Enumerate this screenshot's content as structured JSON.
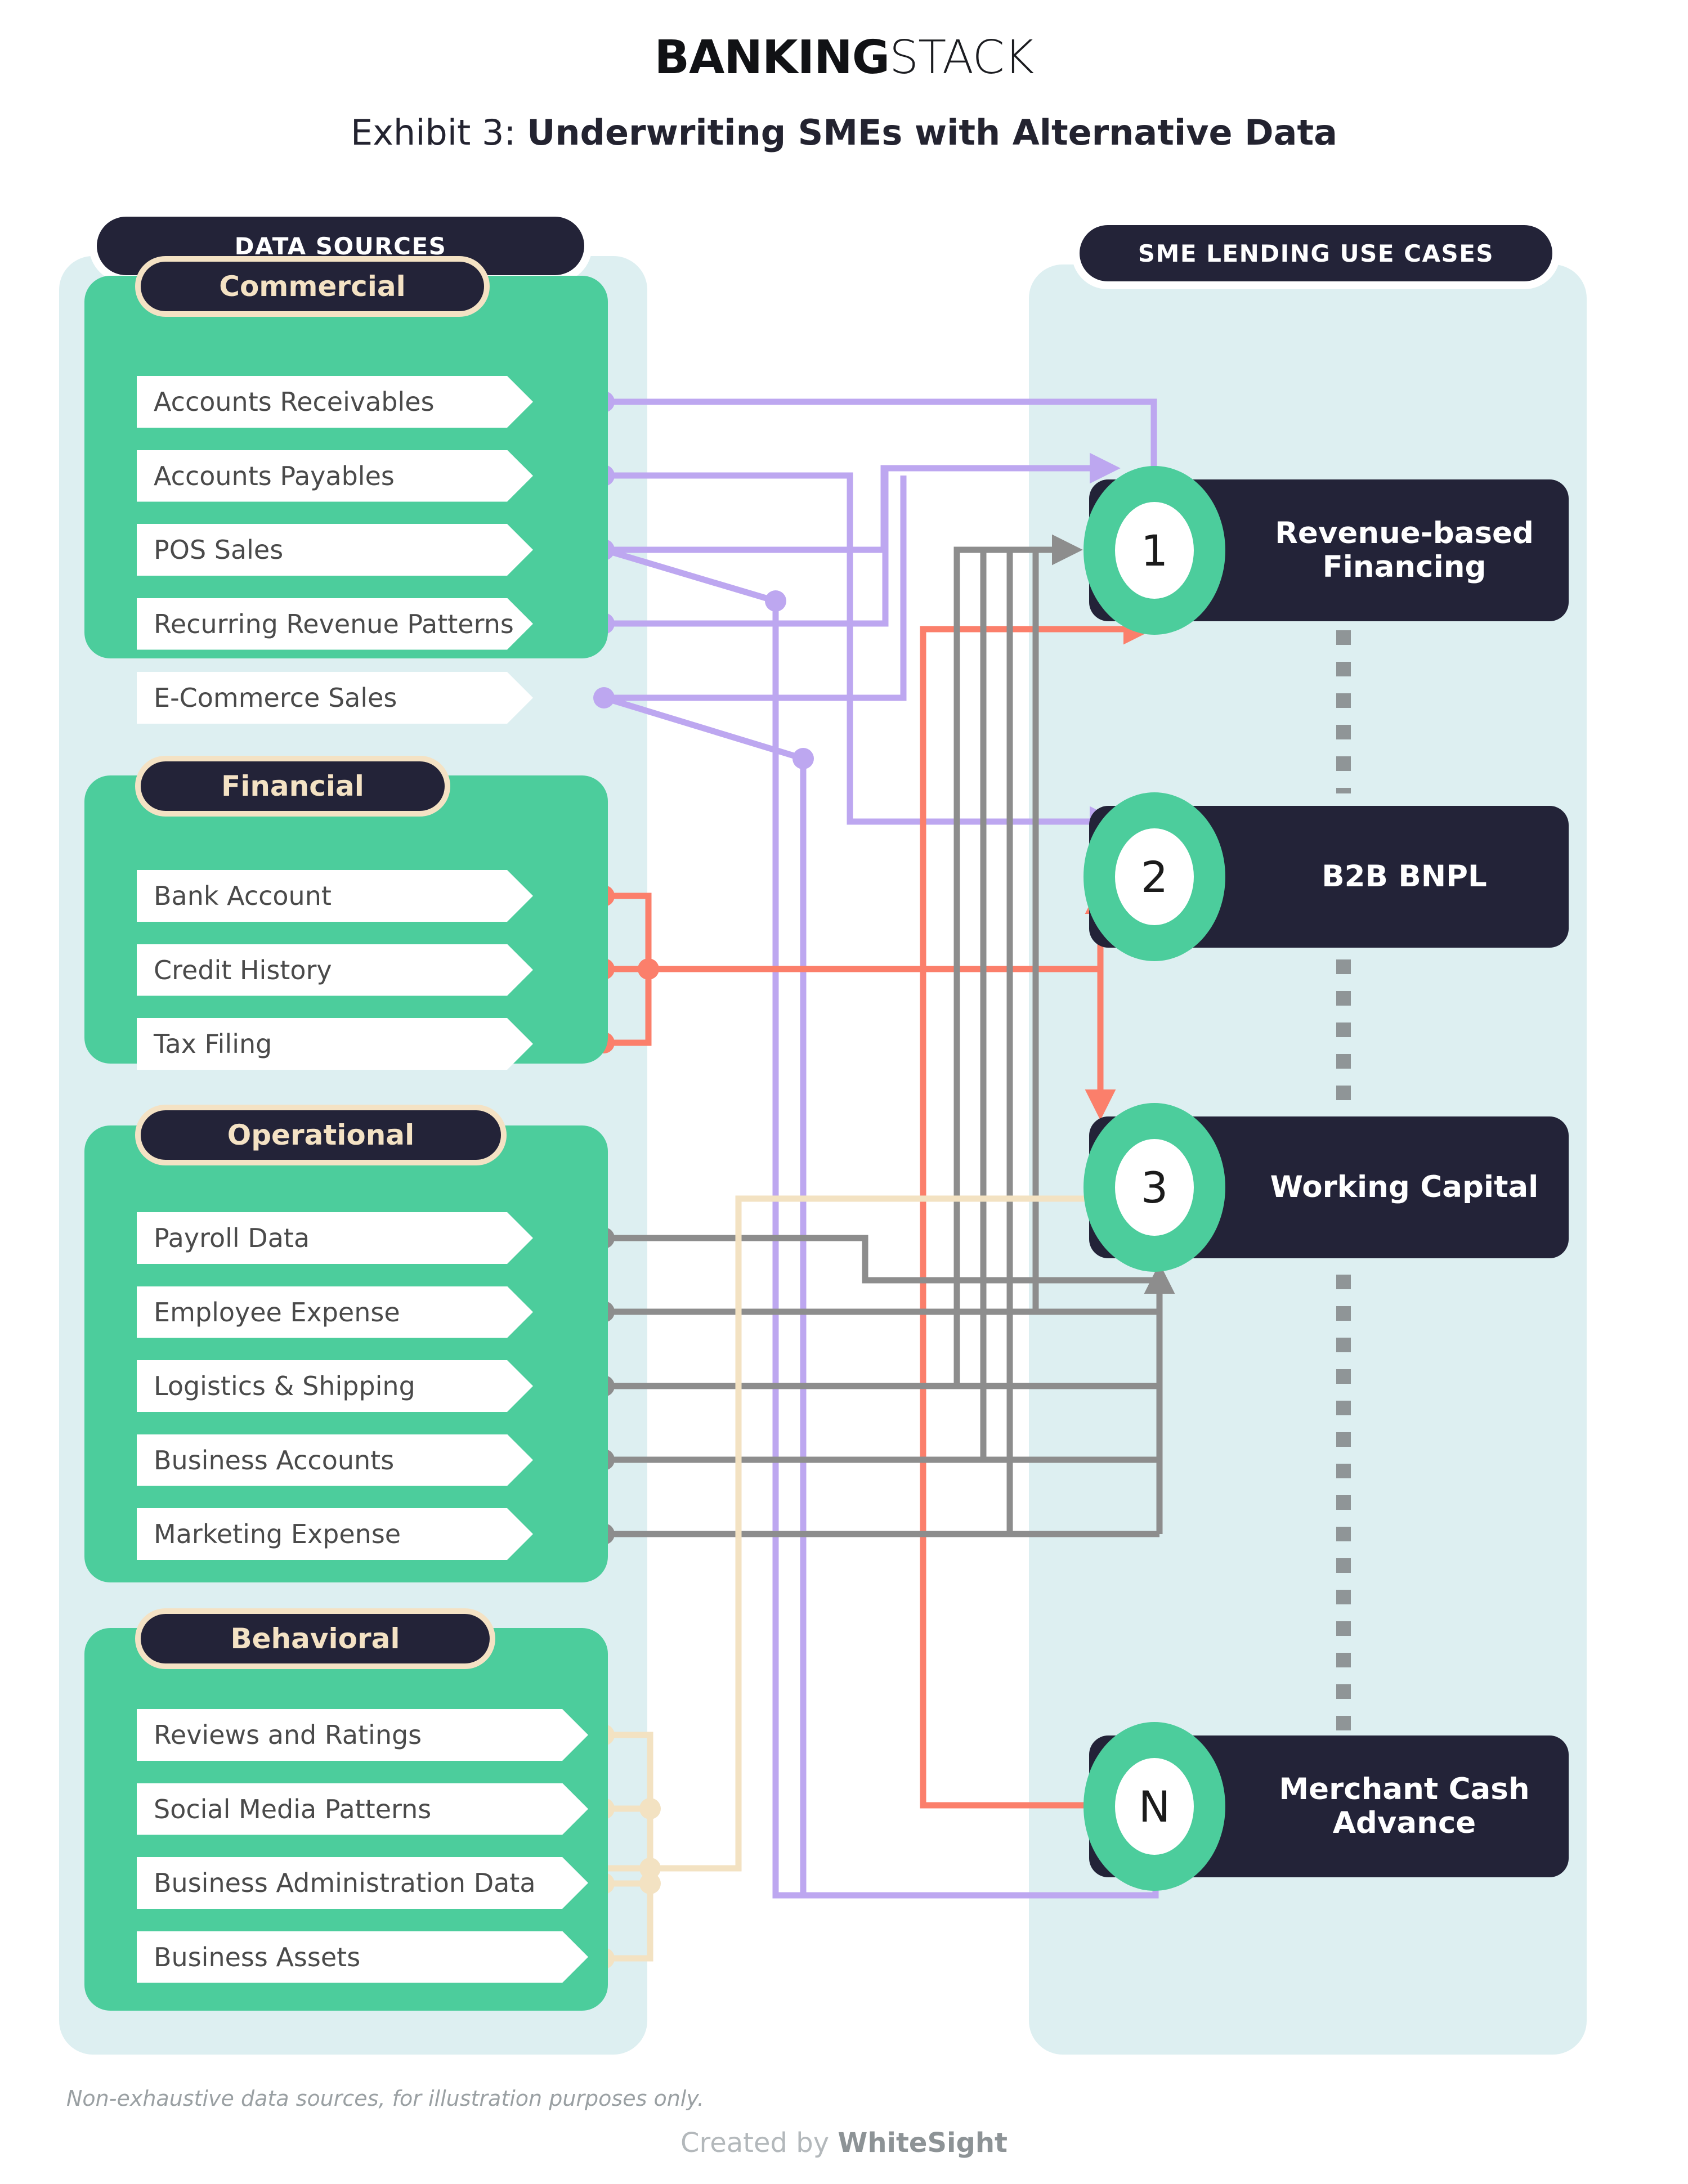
{
  "header": {
    "brand_bold": "BANKING",
    "brand_light": "STACK",
    "exhibit_prefix": "Exhibit 3: ",
    "exhibit_title": "Underwriting SMEs with Alternative Data"
  },
  "left_panel": {
    "tag": "DATA SOURCES",
    "groups": [
      {
        "title": "Commercial",
        "connector_color": "#bda7f0",
        "items": [
          "Accounts Receivables",
          "Accounts Payables",
          "POS Sales",
          "Recurring Revenue Patterns",
          "E-Commerce Sales"
        ]
      },
      {
        "title": "Financial",
        "connector_color": "#fb7f6b",
        "items": [
          "Bank Account",
          "Credit History",
          "Tax Filing"
        ]
      },
      {
        "title": "Operational",
        "connector_color": "#8d8d8d",
        "items": [
          "Payroll Data",
          "Employee Expense",
          "Logistics & Shipping",
          "Business Accounts",
          "Marketing Expense"
        ]
      },
      {
        "title": "Behavioral",
        "connector_color": "#f3e2c2",
        "items": [
          "Reviews and Ratings",
          "Social Media Patterns",
          "Business Administration Data",
          "Business Assets"
        ]
      }
    ]
  },
  "right_panel": {
    "tag": "SME LENDING USE CASES",
    "use_cases": [
      {
        "badge": "1",
        "label": "Revenue-based\nFinancing"
      },
      {
        "badge": "2",
        "label": "B2B BNPL"
      },
      {
        "badge": "3",
        "label": "Working Capital"
      },
      {
        "badge": "N",
        "label": "Merchant Cash\nAdvance"
      }
    ]
  },
  "footer": {
    "footnote": "Non-exhaustive data sources, for illustration purposes only.",
    "credit_light": "Created by ",
    "credit_bold": "WhiteSight"
  },
  "colors": {
    "navy": "#232338",
    "green": "#4ccd9c",
    "panel_bg": "#ddeff1",
    "cream": "#f4e2c4",
    "purple": "#bda7f0",
    "coral": "#fb7f6b",
    "gray": "#8d8d8d",
    "chip_text": "#4a4a4a"
  }
}
